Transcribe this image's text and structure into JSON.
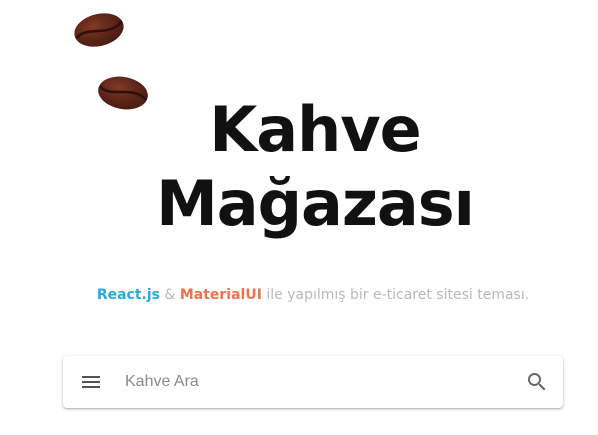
{
  "hero": {
    "title_line_1": "Kahve",
    "title_line_2": "Mağazası"
  },
  "subtitle": {
    "react": "React.js",
    "amp": "&",
    "mui": "MaterialUI",
    "rest": "ile yapılmış bir e-ticaret sitesi teması."
  },
  "search": {
    "placeholder": "Kahve Ara",
    "value": ""
  },
  "icons": {
    "menu": "menu-icon",
    "search": "search-icon",
    "bean": "coffee-bean-icon"
  },
  "colors": {
    "react": "#29a8e0",
    "mui": "#f0724b",
    "muted": "#b9b9b9",
    "bean": "#6b2a1c"
  }
}
